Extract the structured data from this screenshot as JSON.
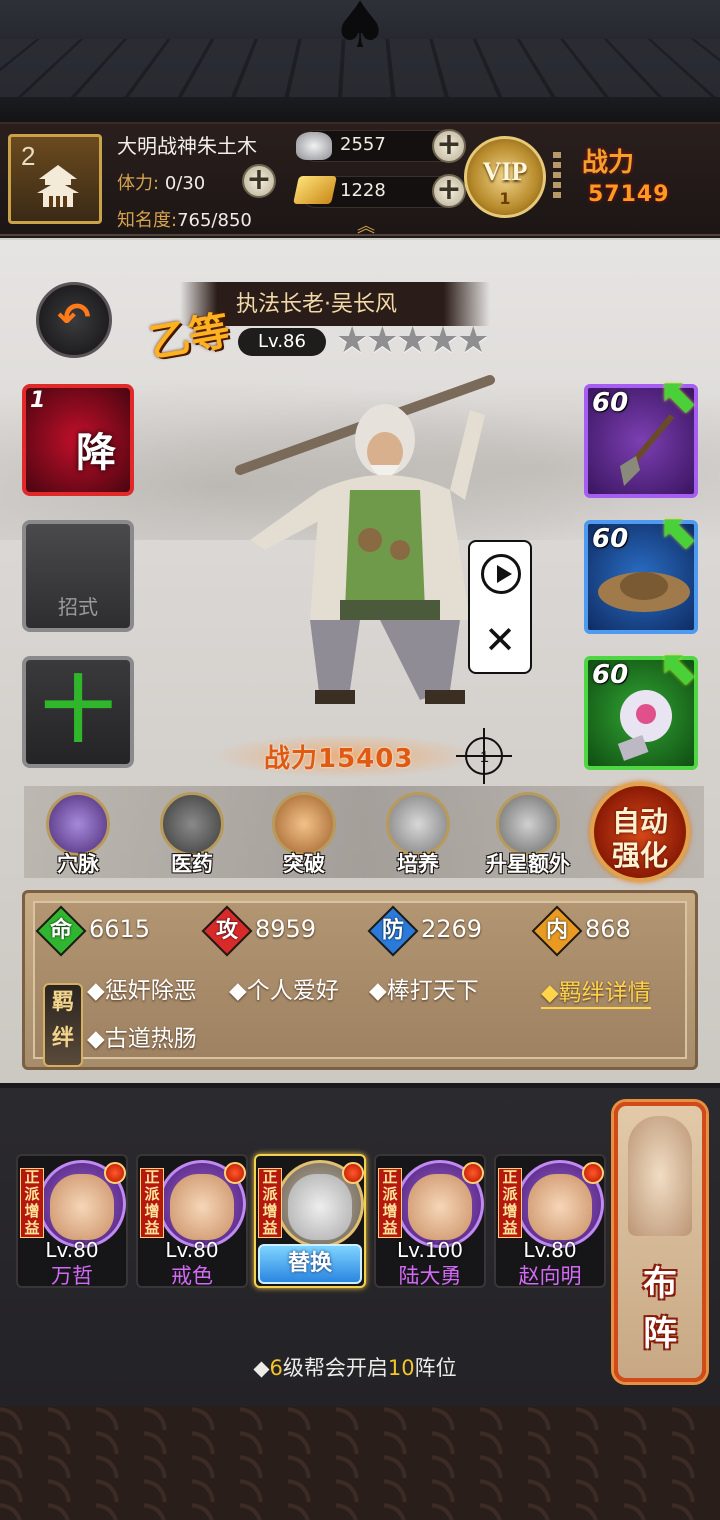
{
  "player": {
    "level": "2",
    "name": "大明战神朱土木",
    "stamina_label": "体力:",
    "stamina_value": "0/30",
    "fame_label": "知名度:",
    "fame_value": "765/850"
  },
  "currency": {
    "silver": "2557",
    "gold": "1228"
  },
  "vip": {
    "label": "VIP",
    "level": "1"
  },
  "top_power": {
    "label": "战力",
    "value": "57149"
  },
  "hero": {
    "grade": "乙等",
    "title": "执法长老·吴长风",
    "level": "Lv.86",
    "stars": "★★★★★",
    "power": "战力15403"
  },
  "skills": {
    "slot1_num": "1",
    "slot1_name": "降",
    "slot2_name": "招式",
    "slot3_name": "十"
  },
  "equipment": [
    {
      "level": "60",
      "item": "shovel",
      "rarity": "purple"
    },
    {
      "level": "60",
      "item": "straw-hat",
      "rarity": "blue"
    },
    {
      "level": "60",
      "item": "wine-pouch",
      "rarity": "green"
    }
  ],
  "functions": [
    "穴脉",
    "医药",
    "突破",
    "培养",
    "升星额外"
  ],
  "auto_enhance": {
    "line1": "自动",
    "line2": "强化"
  },
  "stats": {
    "hp_key": "命",
    "hp": "6615",
    "atk_key": "攻",
    "atk": "8959",
    "def_key": "防",
    "def": "2269",
    "int_key": "内",
    "int": "868"
  },
  "bond": {
    "badge1": "羁",
    "badge2": "绊",
    "items": [
      "◆惩奸除恶",
      "◆个人爱好",
      "◆棒打天下",
      "◆古道热肠"
    ],
    "detail": "◆羁绊详情"
  },
  "team": [
    {
      "tag": "正派增益",
      "level": "Lv.80",
      "name": "万哲"
    },
    {
      "tag": "正派增益",
      "level": "Lv.80",
      "name": "戒色"
    },
    {
      "tag": "正派增益",
      "swap": "替换"
    },
    {
      "tag": "正派增益",
      "level": "Lv.100",
      "name": "陆大勇"
    },
    {
      "tag": "正派增益",
      "level": "Lv.80",
      "name": "赵向明"
    }
  ],
  "formation": {
    "line1": "布",
    "line2": "阵"
  },
  "guild_tip": {
    "pre": "◆",
    "n1": "6",
    "mid": "级帮会开启",
    "n2": "10",
    "post": "阵位"
  },
  "colors": {
    "accent_gold": "#d6a24c",
    "power_orange": "#e05a12",
    "bond_yellow": "#ffd34a",
    "hero_name_purple": "#d26af5"
  }
}
